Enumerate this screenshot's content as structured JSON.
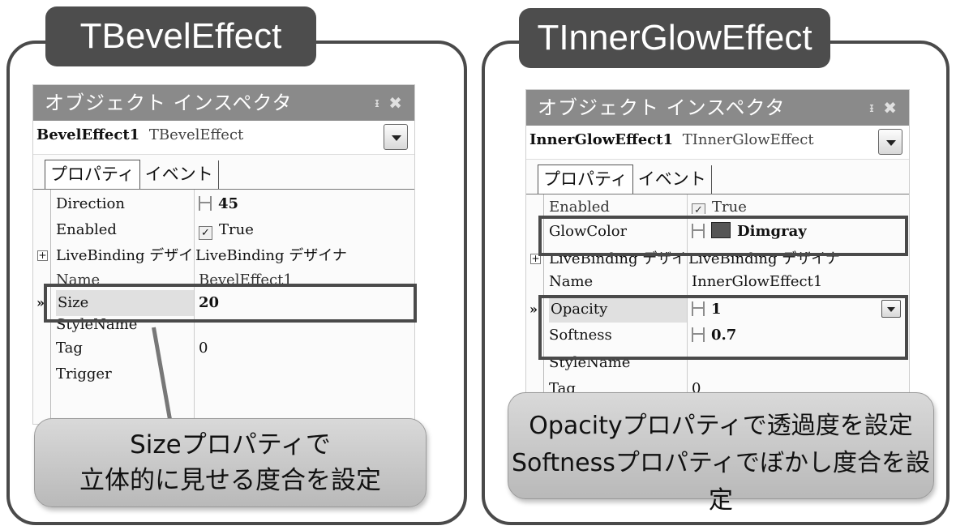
{
  "left_panel": {
    "title": "TBevelEffect",
    "inspector": {
      "title": "オブジェクト インスペクタ",
      "pin": "ᵻ",
      "close": "✖",
      "object_name": "BevelEffect1",
      "object_type": "TBevelEffect",
      "tabs": [
        "プロパティ",
        "イベント"
      ],
      "rows": [
        {
          "name": "Direction",
          "value": "45"
        },
        {
          "name": "Enabled",
          "value": "True"
        },
        {
          "name": "LiveBinding デザイナ",
          "value": "LiveBinding デザイナ"
        },
        {
          "name": "Name",
          "value": "BevelEffect1"
        },
        {
          "name": "Size",
          "value": "20"
        },
        {
          "name": "StyleName",
          "value": ""
        },
        {
          "name": "Tag",
          "value": "0"
        },
        {
          "name": "Trigger",
          "value": ""
        }
      ]
    },
    "callout": [
      "Sizeプロパティで",
      "立体的に見せる度合を設定"
    ]
  },
  "right_panel": {
    "title": "TInnerGlowEffect",
    "inspector": {
      "title": "オブジェクト インスペクタ",
      "pin": "ᵻ",
      "close": "✖",
      "object_name": "InnerGlowEffect1",
      "object_type": "TInnerGlowEffect",
      "tabs": [
        "プロパティ",
        "イベント"
      ],
      "rows": [
        {
          "name": "Enabled",
          "value": "True"
        },
        {
          "name": "GlowColor",
          "value": "Dimgray"
        },
        {
          "name": "LiveBinding デザイナ",
          "value": "LiveBinding デザイナ"
        },
        {
          "name": "Name",
          "value": "InnerGlowEffect1"
        },
        {
          "name": "Opacity",
          "value": "1"
        },
        {
          "name": "Softness",
          "value": "0.7"
        },
        {
          "name": "StyleName",
          "value": ""
        },
        {
          "name": "Tag",
          "value": "0"
        }
      ]
    },
    "callout": [
      "Opacityプロパティで透過度を設定",
      "Softnessプロパティでぼかし度合を設定"
    ]
  },
  "colors": {
    "title_tab": "#4d4d4d",
    "inspector_title": "#8a8a8a",
    "glow_swatch": "#555555"
  }
}
